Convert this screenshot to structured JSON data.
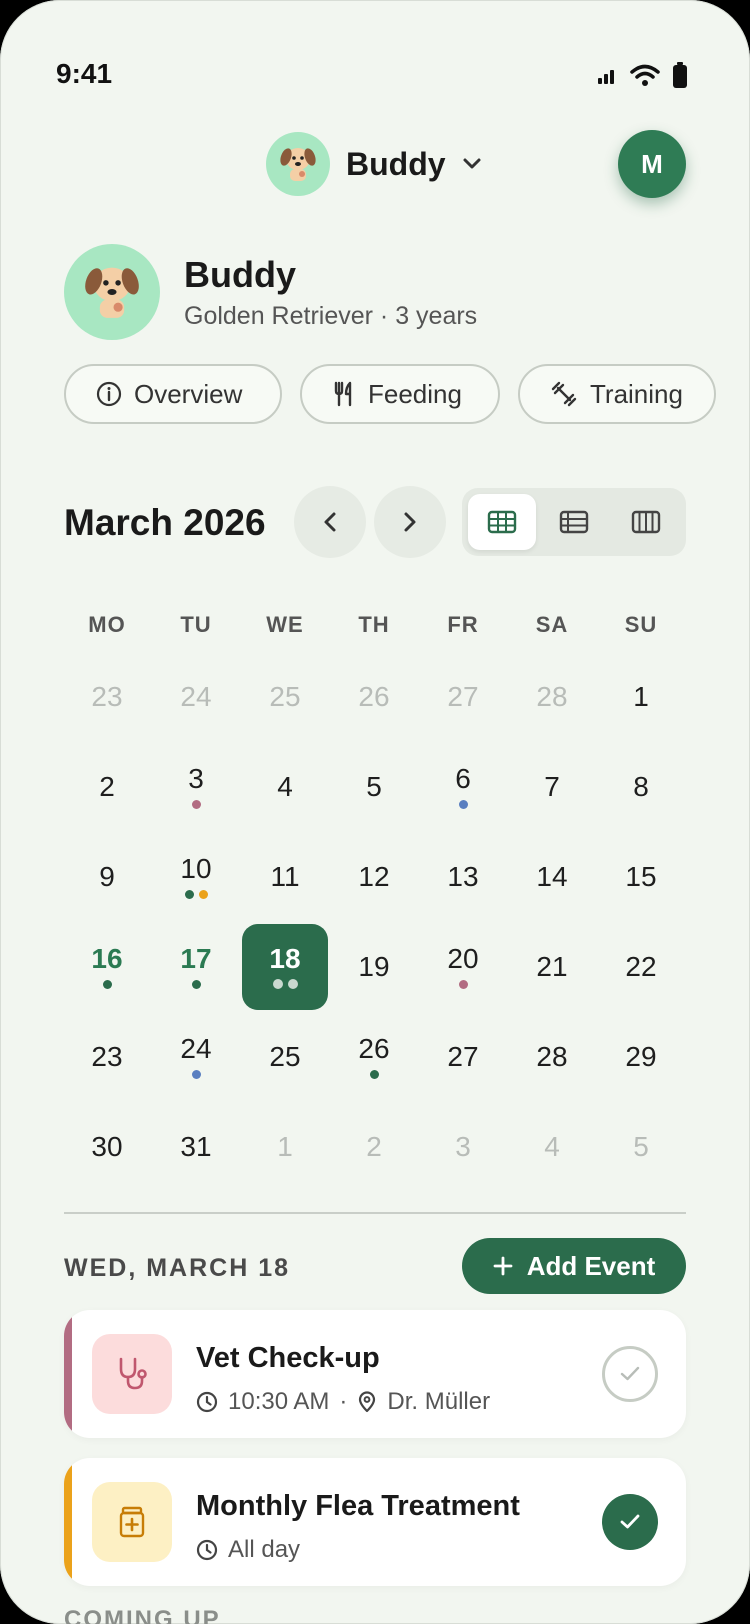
{
  "status": {
    "time": "9:41"
  },
  "header": {
    "pet_name": "Buddy",
    "user_initial": "M"
  },
  "profile": {
    "name": "Buddy",
    "description": "Golden Retriever · 3 years"
  },
  "chips": {
    "overview": "Overview",
    "feeding": "Feeding",
    "training": "Training"
  },
  "calendar": {
    "month": "March 2026",
    "weekdays": [
      "MO",
      "TU",
      "WE",
      "TH",
      "FR",
      "SA",
      "SU"
    ],
    "weeks": [
      [
        {
          "d": "23",
          "o": true
        },
        {
          "d": "24",
          "o": true
        },
        {
          "d": "25",
          "o": true
        },
        {
          "d": "26",
          "o": true
        },
        {
          "d": "27",
          "o": true
        },
        {
          "d": "28",
          "o": true
        },
        {
          "d": "1"
        }
      ],
      [
        {
          "d": "2"
        },
        {
          "d": "3",
          "dots": [
            "vet"
          ]
        },
        {
          "d": "4"
        },
        {
          "d": "5"
        },
        {
          "d": "6",
          "dots": [
            "groom"
          ]
        },
        {
          "d": "7"
        },
        {
          "d": "8"
        }
      ],
      [
        {
          "d": "9"
        },
        {
          "d": "10",
          "dots": [
            "green",
            "orange"
          ]
        },
        {
          "d": "11"
        },
        {
          "d": "12"
        },
        {
          "d": "13"
        },
        {
          "d": "14"
        },
        {
          "d": "15"
        }
      ],
      [
        {
          "d": "16",
          "h": true,
          "dots": [
            "green"
          ]
        },
        {
          "d": "17",
          "h": true,
          "dots": [
            "green"
          ]
        },
        {
          "d": "18",
          "s": true,
          "dots": [
            "white",
            "white"
          ]
        },
        {
          "d": "19"
        },
        {
          "d": "20",
          "dots": [
            "vet"
          ]
        },
        {
          "d": "21"
        },
        {
          "d": "22"
        }
      ],
      [
        {
          "d": "23"
        },
        {
          "d": "24",
          "dots": [
            "groom"
          ]
        },
        {
          "d": "25"
        },
        {
          "d": "26",
          "dots": [
            "green"
          ]
        },
        {
          "d": "27"
        },
        {
          "d": "28"
        },
        {
          "d": "29"
        }
      ],
      [
        {
          "d": "30"
        },
        {
          "d": "31"
        },
        {
          "d": "1",
          "o": true
        },
        {
          "d": "2",
          "o": true
        },
        {
          "d": "3",
          "o": true
        },
        {
          "d": "4",
          "o": true
        },
        {
          "d": "5",
          "o": true
        }
      ]
    ]
  },
  "agenda": {
    "date_label": "WED, MARCH 18",
    "add_label": "Add Event",
    "events": [
      {
        "title": "Vet Check-up",
        "time": "10:30 AM",
        "separator": "·",
        "location": "Dr. Müller",
        "color": "#b26c82",
        "icon": "stethoscope-icon",
        "done": false
      },
      {
        "title": "Monthly Flea Treatment",
        "time": "All day",
        "color": "#eba21a",
        "icon": "medicine-icon",
        "done": true
      }
    ],
    "upcoming_label": "COMING UP"
  }
}
